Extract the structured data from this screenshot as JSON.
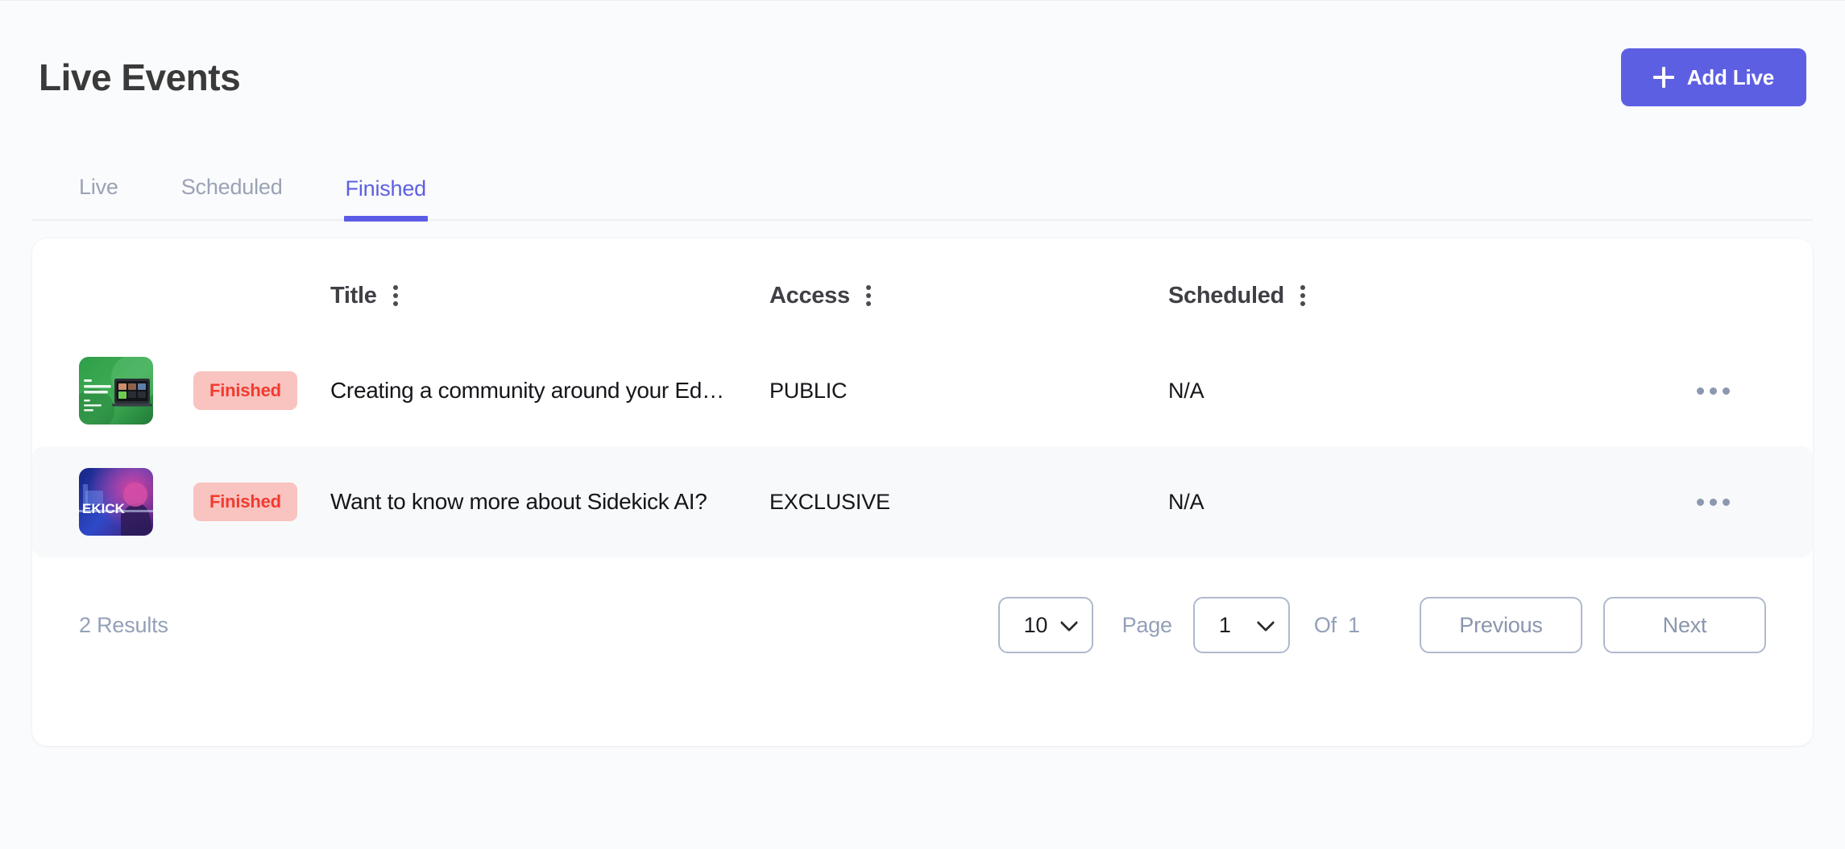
{
  "header": {
    "title": "Live Events",
    "add_button_label": "Add Live",
    "add_button_icon": "plus-icon",
    "accent_color": "#5D5FE3"
  },
  "tabs": [
    {
      "label": "Live",
      "active": false
    },
    {
      "label": "Scheduled",
      "active": false
    },
    {
      "label": "Finished",
      "active": true
    }
  ],
  "table": {
    "columns": [
      {
        "label": "Title",
        "menu_icon": "kebab-vertical-icon"
      },
      {
        "label": "Access",
        "menu_icon": "kebab-vertical-icon"
      },
      {
        "label": "Scheduled",
        "menu_icon": "kebab-vertical-icon"
      }
    ],
    "rows": [
      {
        "thumbnail_alt": "green-community-thumbnail",
        "status": "Finished",
        "title": "Creating a community around your Ed…",
        "access": "PUBLIC",
        "scheduled": "N/A",
        "actions_icon": "kebab-horizontal-icon"
      },
      {
        "thumbnail_alt": "sidekick-ai-thumbnail",
        "status": "Finished",
        "title": "Want to know more about Sidekick AI?",
        "access": "EXCLUSIVE",
        "scheduled": "N/A",
        "actions_icon": "kebab-horizontal-icon"
      }
    ]
  },
  "footer": {
    "results_text": "2 Results",
    "page_size": "10",
    "page_label": "Page",
    "current_page": "1",
    "of_label": "Of",
    "total_pages": "1",
    "previous_label": "Previous",
    "next_label": "Next"
  },
  "status_colors": {
    "finished_bg": "#F9C3C0",
    "finished_text": "#F23B2F"
  }
}
